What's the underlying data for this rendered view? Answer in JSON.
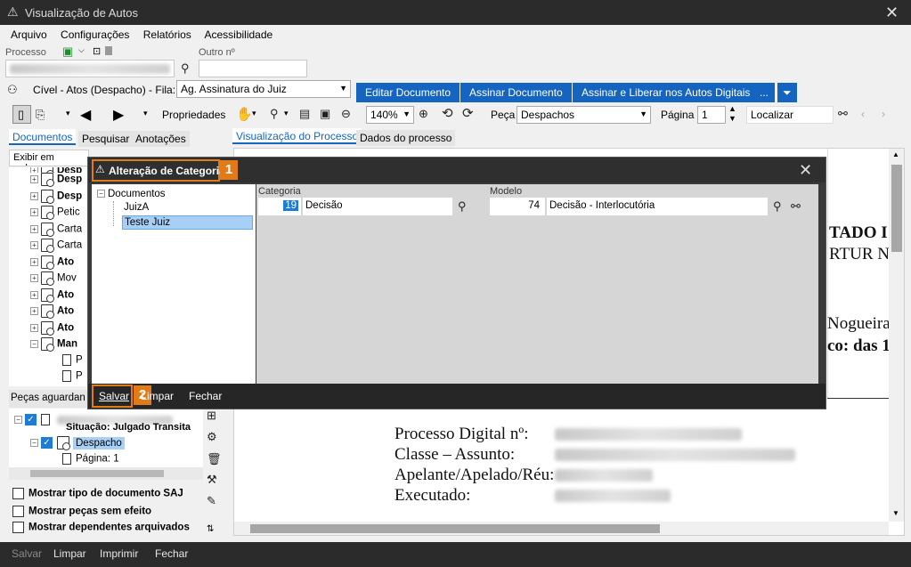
{
  "window": {
    "title": "Visualização de Autos"
  },
  "menu": [
    "Arquivo",
    "Configurações",
    "Relatórios",
    "Acessibilidade"
  ],
  "search": {
    "processo_label": "Processo",
    "outro_label": "Outro nº"
  },
  "fila": {
    "label": "Cível - Atos (Despacho) - Fila:",
    "value": "Ag. Assinatura do Juiz"
  },
  "actions": {
    "editar": "Editar Documento",
    "assinar": "Assinar Documento",
    "assinar_liberar": "Assinar e Liberar nos Autos Digitais",
    "more": "..."
  },
  "toolbar": {
    "propriedades": "Propriedades",
    "zoom": "140%",
    "peca_label": "Peça",
    "peca_value": "Despachos",
    "pagina_label": "Página",
    "pagina_value": "1",
    "localizar": "Localizar"
  },
  "left_tabs": [
    "Documentos",
    "Pesquisar",
    "Anotações"
  ],
  "left_filter": "Exibir em ordem",
  "tree_items": [
    "Desp",
    "Desp",
    "Desp",
    "Petic",
    "Carta",
    "Carta",
    "Ato",
    "Mov",
    "Ato",
    "Ato",
    "Ato",
    "Man"
  ],
  "tree_pages": [
    "P",
    "P"
  ],
  "pending": {
    "title": "Peças aguardan",
    "situacao": "Situação: Julgado Transita",
    "despacho": "Despacho",
    "pagina": "Página: 1"
  },
  "options": [
    "Mostrar tipo de documento SAJ",
    "Mostrar peças sem efeito",
    "Mostrar dependentes arquivados"
  ],
  "view_tabs": [
    "Visualização do Processo",
    "Dados do processo"
  ],
  "document": {
    "right_fragments": [
      "TADO I",
      "RTUR N",
      "Nogueira",
      "co: das 1"
    ],
    "fields": [
      "Processo Digital nº:",
      "Classe – Assunto:",
      "Apelante/Apelado/Réu:",
      "Executado:"
    ]
  },
  "dialog": {
    "title": "Alteração de Categoria",
    "step1": "1",
    "step2": "2",
    "tree_root": "Documentos",
    "tree_children": [
      "JuizA",
      "Teste Juiz"
    ],
    "categoria_label": "Categoria",
    "categoria_code": "19",
    "categoria_value": "Decisão",
    "modelo_label": "Modelo",
    "modelo_code": "74",
    "modelo_value": "Decisão - Interlocutória",
    "salvar": "Salvar",
    "limpar": "Limpar",
    "fechar": "Fechar"
  },
  "bottom": {
    "salvar": "Salvar",
    "limpar": "Limpar",
    "imprimir": "Imprimir",
    "fechar": "Fechar"
  },
  "colors": {
    "accent": "#1565c0",
    "highlight": "#e07b18",
    "dark_bar": "#2b2b2b"
  }
}
